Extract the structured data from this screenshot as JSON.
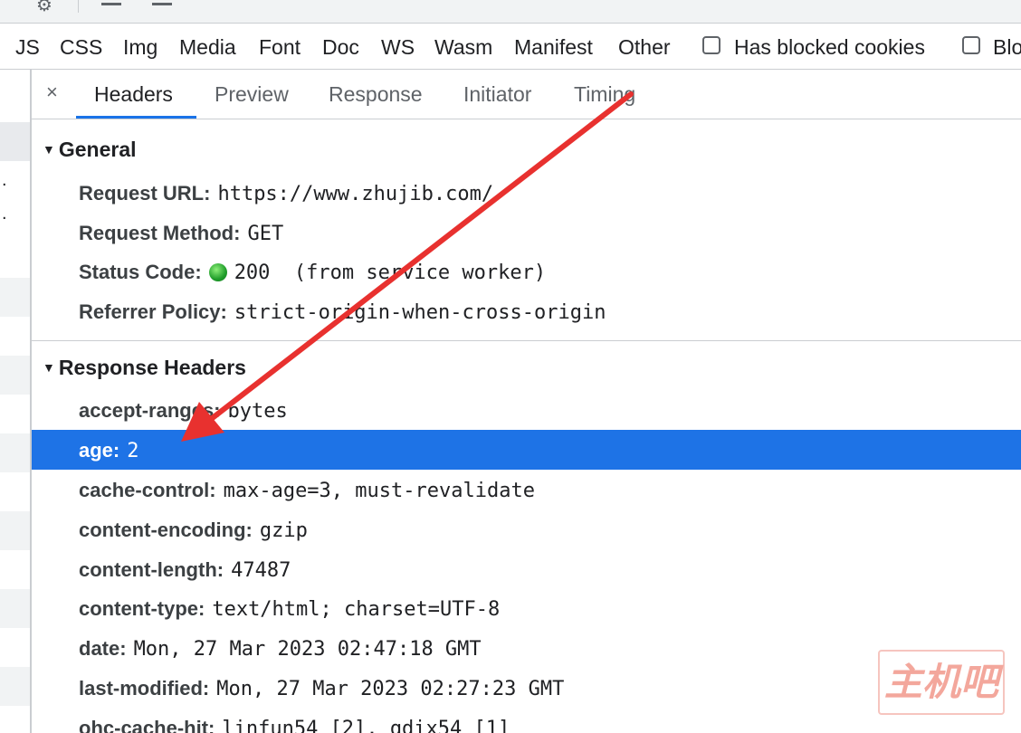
{
  "toolbar": {
    "icons": [
      "settings-gear-icon",
      "upload-icon",
      "download-icon"
    ]
  },
  "filters": {
    "types": [
      "JS",
      "CSS",
      "Img",
      "Media",
      "Font",
      "Doc",
      "WS",
      "Wasm",
      "Manifest",
      "Other"
    ],
    "checkboxes": [
      {
        "label": "Has blocked cookies",
        "checked": false
      },
      {
        "label": "Blo",
        "checked": false
      }
    ]
  },
  "tabs": {
    "close_glyph": "×",
    "items": [
      "Headers",
      "Preview",
      "Response",
      "Initiator",
      "Timing"
    ],
    "active": "Headers"
  },
  "general": {
    "title": "General",
    "rows": [
      {
        "key": "Request URL:",
        "value": "https://www.zhujib.com/"
      },
      {
        "key": "Request Method:",
        "value": "GET"
      },
      {
        "key": "Status Code:",
        "value": "200  (from service worker)"
      },
      {
        "key": "Referrer Policy:",
        "value": "strict-origin-when-cross-origin"
      }
    ]
  },
  "response_headers": {
    "title": "Response Headers",
    "rows": [
      {
        "key": "accept-ranges:",
        "value": "bytes"
      },
      {
        "key": "age:",
        "value": "2"
      },
      {
        "key": "cache-control:",
        "value": "max-age=3, must-revalidate"
      },
      {
        "key": "content-encoding:",
        "value": "gzip"
      },
      {
        "key": "content-length:",
        "value": "47487"
      },
      {
        "key": "content-type:",
        "value": "text/html; charset=UTF-8"
      },
      {
        "key": "date:",
        "value": "Mon, 27 Mar 2023 02:47:18 GMT"
      },
      {
        "key": "last-modified:",
        "value": "Mon, 27 Mar 2023 02:27:23 GMT"
      },
      {
        "key": "ohc-cache-hit:",
        "value": "linfun54 [2], qdix54 [1]"
      }
    ],
    "selected": "age:"
  },
  "watermark": {
    "text": "主机吧"
  },
  "colors": {
    "selection": "#1e73e6",
    "tab_accent": "#1a73e8",
    "status_ok": "#1f9d2a",
    "annotation_arrow": "#e8312f"
  }
}
